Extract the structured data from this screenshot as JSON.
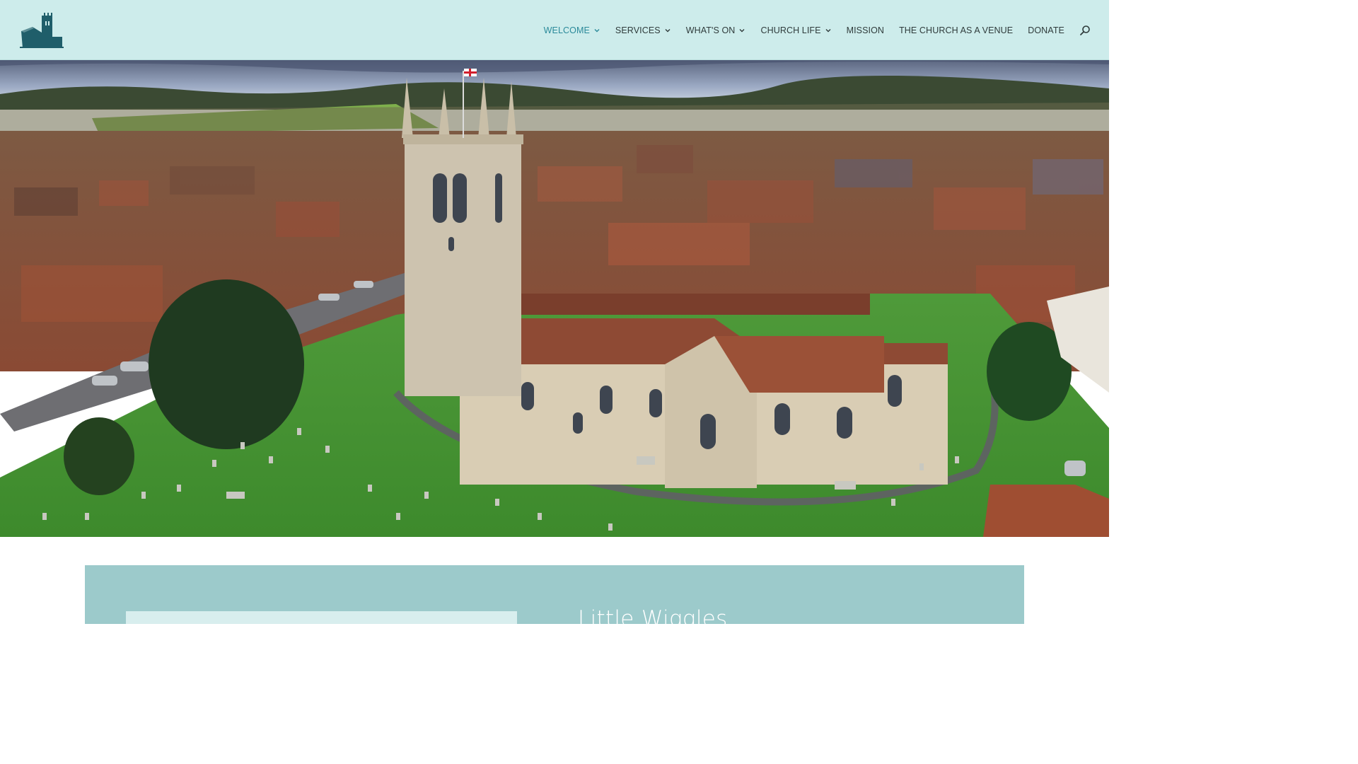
{
  "header": {
    "logo_icon": "church-tower-logo-icon",
    "nav": [
      {
        "label": "WELCOME",
        "has_dropdown": true,
        "active": true
      },
      {
        "label": "SERVICES",
        "has_dropdown": true,
        "active": false
      },
      {
        "label": "WHAT'S ON",
        "has_dropdown": true,
        "active": false
      },
      {
        "label": "CHURCH LIFE",
        "has_dropdown": true,
        "active": false
      },
      {
        "label": "MISSION",
        "has_dropdown": false,
        "active": false
      },
      {
        "label": "THE CHURCH AS A VENUE",
        "has_dropdown": false,
        "active": false
      },
      {
        "label": "DONATE",
        "has_dropdown": false,
        "active": false
      }
    ],
    "search_icon": "search-icon"
  },
  "hero": {
    "image": "aerial-church-photo"
  },
  "feature": {
    "title": "Little Wiggles"
  },
  "colors": {
    "header_bg": "#cdeceb",
    "accent": "#2b8a9a",
    "nav_text": "#2f3b3b",
    "section_bg": "#9ccacb",
    "logo": "#1f5e6a"
  }
}
